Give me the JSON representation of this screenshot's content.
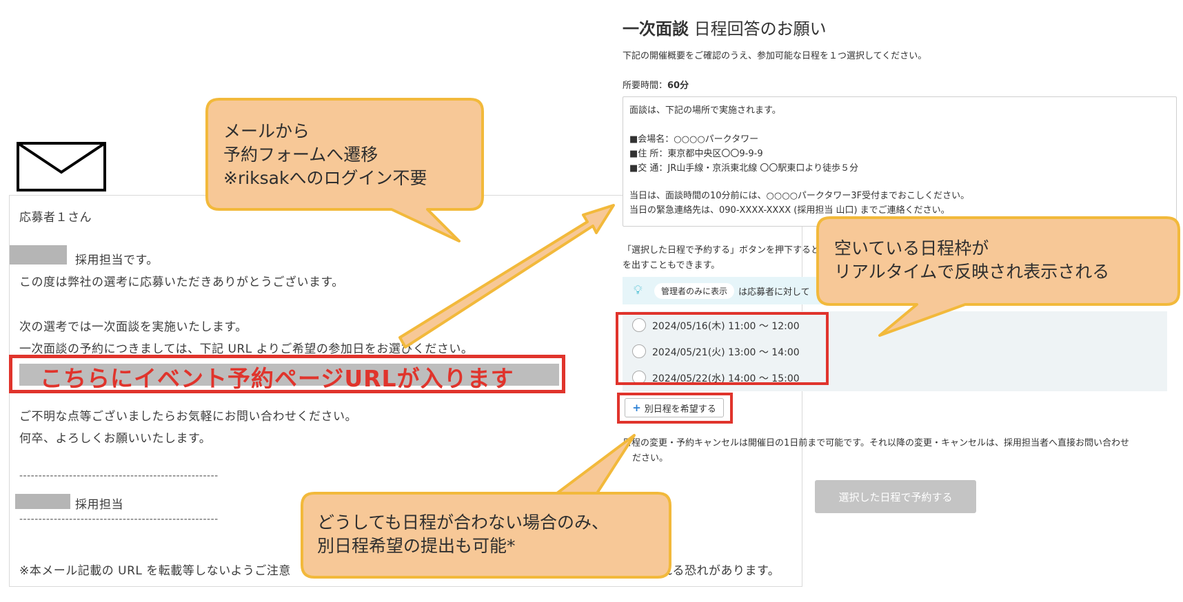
{
  "email": {
    "greeting": "応募者１さん",
    "sender_line": "採用担当です。",
    "thanks": "この度は弊社の選考に応募いただきありがとうございます。",
    "next_step": "次の選考では一次面談を実施いたします。",
    "url_instruction": "一次面談の予約につきましては、下記 URL よりご希望の参加日をお選びください。",
    "url_placeholder": "こちらにイベント予約ページURLが入ります",
    "contact": "ご不明な点等ございましたらお気軽にお問い合わせください。",
    "closing": "何卒、よろしくお願いいたします。",
    "divider": "----------------------------------------------------",
    "signature": "採用担当",
    "footer_start": "※本メール記載の URL を転載等しないようご注意",
    "footer_end": "れる恐れがあります。"
  },
  "form": {
    "title_bold": "一次面談",
    "title_rest": " 日程回答のお願い",
    "subtitle": "下記の開催概要をご確認のうえ、参加可能な日程を１つ選択してください。",
    "duration_label": "所要時間：",
    "duration_value": "60分",
    "info_lines": [
      "面談は、下記の場所で実施されます。",
      "■会場名：○○○○パークタワー",
      "■住 所：東京都中央区〇〇9-9-9",
      "■交 通：JR山手線・京浜東北線 〇〇駅東口より徒歩５分",
      "当日は、面談時間の10分前には、○○○○パークタワー3F受付までおこしください。",
      "当日の緊急連絡先は、090-XXXX-XXXX (採用担当 山口) までご連絡ください。"
    ],
    "button_note_1": "「選択した日程で予約する」ボタンを押下すると",
    "button_note_2": "を出すこともできます。",
    "admin_badge": "管理者のみに表示",
    "admin_text": "は応募者に対して",
    "slots": [
      "2024/05/16(木) 11:00 ～ 12:00",
      "2024/05/21(火) 13:00 ～ 14:00",
      "2024/05/22(水) 14:00 ～ 15:00"
    ],
    "alt_button": "別日程を希望する",
    "cancel_note_1": "日程の変更・予約キャンセルは開催日の1日前まで可能です。それ以降の変更・キャンセルは、採用担当者へ直接お問い合わせ",
    "cancel_note_2": "ださい。",
    "submit_button": "選択した日程で予約する"
  },
  "callouts": {
    "mail_transition": [
      "メールから",
      "予約フォームへ遷移",
      "※riksakへのログイン不要"
    ],
    "realtime": [
      "空いている日程枠が",
      "リアルタイムで反映され表示される"
    ],
    "alt_schedule": [
      "どうしても日程が合わない場合のみ、",
      "別日程希望の提出も可能*"
    ]
  },
  "colors": {
    "callout_fill": "#f7c897",
    "callout_border": "#f2b93b",
    "highlight_red": "#e0342c"
  }
}
